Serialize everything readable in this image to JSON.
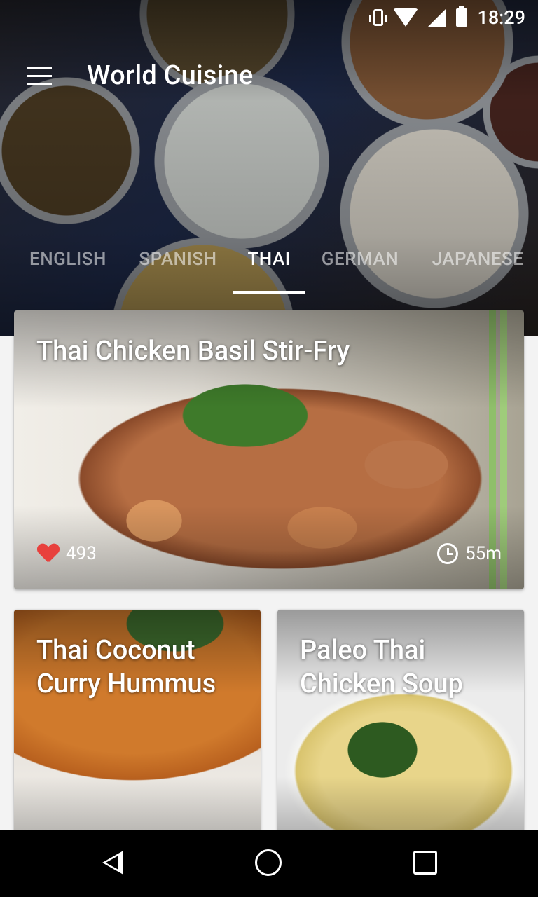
{
  "status_bar": {
    "time": "18:29",
    "icons": [
      "vibrate-icon",
      "wifi-icon",
      "signal-icon",
      "battery-icon"
    ]
  },
  "toolbar": {
    "title": "World Cuisine",
    "menu_icon": "hamburger-menu-icon"
  },
  "tabs": [
    {
      "label": "ENGLISH",
      "active": false
    },
    {
      "label": "SPANISH",
      "active": false
    },
    {
      "label": "THAI",
      "active": true
    },
    {
      "label": "GERMAN",
      "active": false
    },
    {
      "label": "JAPANESE",
      "active": false
    }
  ],
  "recipes": [
    {
      "title": "Thai Chicken Basil Stir-Fry",
      "likes": "493",
      "duration": "55m"
    },
    {
      "title": "Thai Coconut Curry Hummus"
    },
    {
      "title": "Paleo Thai Chicken Soup"
    }
  ],
  "nav_bar": {
    "icons": [
      "back-icon",
      "home-icon",
      "recents-icon"
    ]
  },
  "colors": {
    "accent_like": "#e8413d",
    "background": "#f3f3f3",
    "nav_bar": "#000000"
  }
}
